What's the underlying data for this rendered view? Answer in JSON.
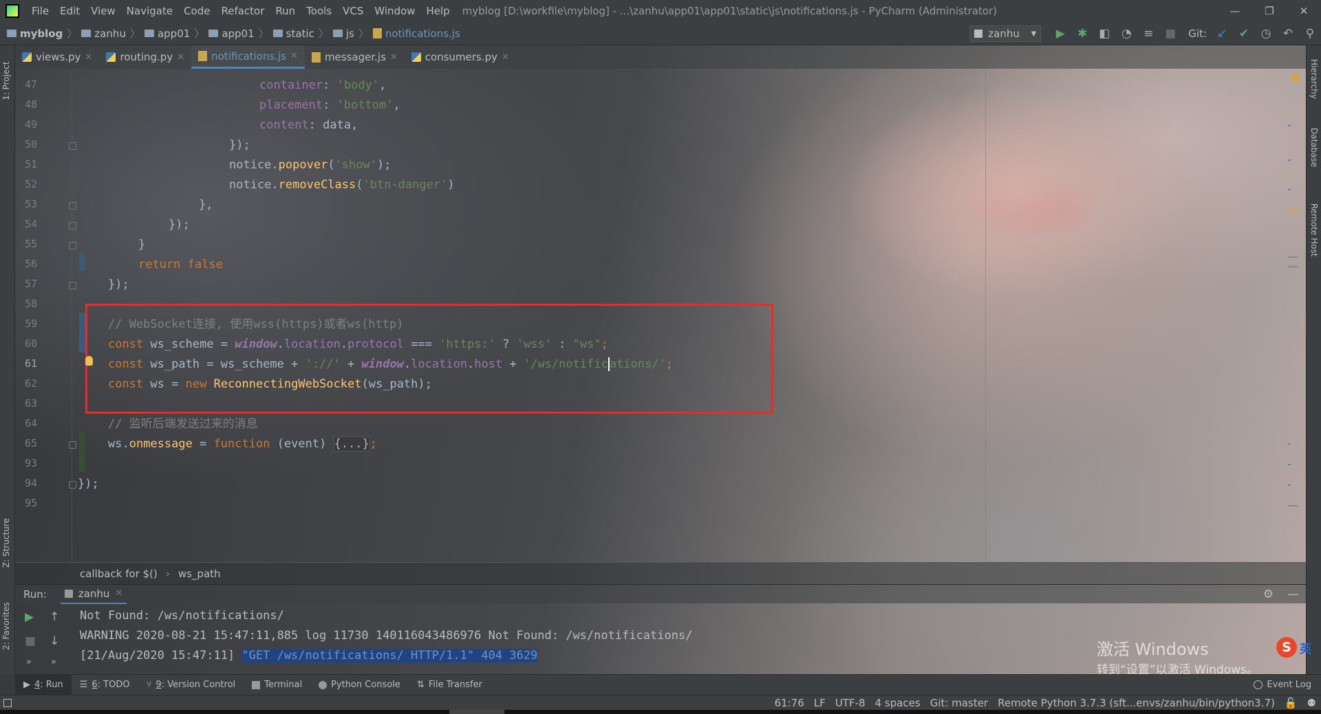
{
  "window": {
    "menu": [
      "File",
      "Edit",
      "View",
      "Navigate",
      "Code",
      "Refactor",
      "Run",
      "Tools",
      "VCS",
      "Window",
      "Help"
    ],
    "title": "myblog [D:\\workfile\\myblog] - ...\\zanhu\\app01\\app01\\static\\js\\notifications.js - PyCharm (Administrator)",
    "controls": [
      "—",
      "❐",
      "✕"
    ]
  },
  "navbar": {
    "crumbs": [
      "myblog",
      "zanhu",
      "app01",
      "app01",
      "static",
      "js",
      "notifications.js"
    ],
    "run_config": "zanhu",
    "git_label": "Git:"
  },
  "left_strip": {
    "project": "1: Project",
    "structure": "Z: Structure",
    "favorites": "2: Favorites"
  },
  "right_strip": {
    "hierarchy": "Hierarchy",
    "database": "Database",
    "remote_host": "Remote Host"
  },
  "tabs": [
    {
      "label": "views.py",
      "type": "py"
    },
    {
      "label": "routing.py",
      "type": "py"
    },
    {
      "label": "notifications.js",
      "type": "js",
      "active": true
    },
    {
      "label": "messager.js",
      "type": "js"
    },
    {
      "label": "consumers.py",
      "type": "py"
    }
  ],
  "line_numbers": [
    "47",
    "48",
    "49",
    "50",
    "51",
    "52",
    "53",
    "54",
    "55",
    "56",
    "57",
    "58",
    "59",
    "60",
    "61",
    "62",
    "63",
    "64",
    "65",
    "93",
    "94",
    "95"
  ],
  "code": {
    "l47": {
      "a": "container",
      "b": ": ",
      "c": "'body'",
      "d": ","
    },
    "l48": {
      "a": "placement",
      "b": ": ",
      "c": "'bottom'",
      "d": ","
    },
    "l49": {
      "a": "content",
      "b": ": data,"
    },
    "l50": {
      "a": "});"
    },
    "l51": {
      "a": "notice.",
      "b": "popover",
      "c": "(",
      "d": "'show'",
      "e": ");"
    },
    "l52": {
      "a": "notice.",
      "b": "removeClass",
      "c": "(",
      "d": "'btn-danger'",
      "e": ")"
    },
    "l53": {
      "a": "},"
    },
    "l54": {
      "a": "});"
    },
    "l55": {
      "a": "}"
    },
    "l56": {
      "a": "return false"
    },
    "l57": {
      "a": "});"
    },
    "l59": {
      "a": "// WebSocket连接, 使用wss(https)或者ws(http)"
    },
    "l60": {
      "kw": "const",
      "a": " ws_scheme = ",
      "g": "window",
      "b": ".",
      "p1": "location",
      "c": ".",
      "p2": "protocol",
      "d": " === ",
      "s1": "'https:'",
      "e": " ? ",
      "s2": "'wss'",
      "f": " : ",
      "s3": "\"ws\"",
      "h": ";"
    },
    "l61": {
      "kw": "const",
      "a": " ws_path = ws_scheme + ",
      "s1": "'://'",
      "b": " + ",
      "g": "window",
      "c": ".",
      "p1": "location",
      "d": ".",
      "p2": "host",
      "e": " + ",
      "s2a": "'/ws/notific",
      "s2b": "ations/'",
      "h": ";"
    },
    "l62": {
      "kw": "const",
      "a": " ws = ",
      "kw2": "new",
      "b": " ",
      "fn": "ReconnectingWebSocket",
      "c": "(ws_path);"
    },
    "l64": {
      "a": "// 监听后端发送过来的消息"
    },
    "l65": {
      "a": "ws.",
      "p": "onmessage",
      "b": " = ",
      "kw": "function",
      "c": " (event) ",
      "fold": "{...}",
      "d": ";"
    },
    "l94": {
      "a": "});"
    }
  },
  "editor_breadcrumb": [
    "callback for $()",
    "ws_path"
  ],
  "run_panel": {
    "label": "Run:",
    "tab": "zanhu",
    "console": [
      "Not Found: /ws/notifications/",
      "WARNING 2020-08-21 15:47:11,885 log 11730 140116043486976 Not Found: /ws/notifications/"
    ],
    "last_prefix": "[21/Aug/2020 15:47:11] ",
    "last_selected": "\"GET /ws/notifications/ HTTP/1.1\" 404 3629"
  },
  "watermark": {
    "line1": "激活 Windows",
    "line2": "转到“设置”以激活 Windows。"
  },
  "ime": {
    "logo": "S",
    "mode": "英"
  },
  "bottom_tabs": [
    {
      "num": "4",
      "label": ": Run",
      "active": true
    },
    {
      "num": "6",
      "label": ": TODO"
    },
    {
      "num": "9",
      "label": ": Version Control"
    },
    {
      "num": "",
      "label": "Terminal"
    },
    {
      "num": "",
      "label": "Python Console"
    },
    {
      "num": "",
      "label": "File Transfer"
    }
  ],
  "event_log": "Event Log",
  "status": {
    "position": "61:76",
    "line_sep": "LF",
    "encoding": "UTF-8",
    "indent": "4 spaces",
    "branch": "Git: master",
    "interpreter": "Remote Python 3.7.3 (sft...envs/zanhu/bin/python3.7)"
  },
  "colors": {
    "keyword": "#cc7832",
    "string": "#6a8759",
    "property": "#9876aa",
    "function": "#ffc66d",
    "comment": "#808080",
    "highlight_box": "#ee2a24"
  }
}
